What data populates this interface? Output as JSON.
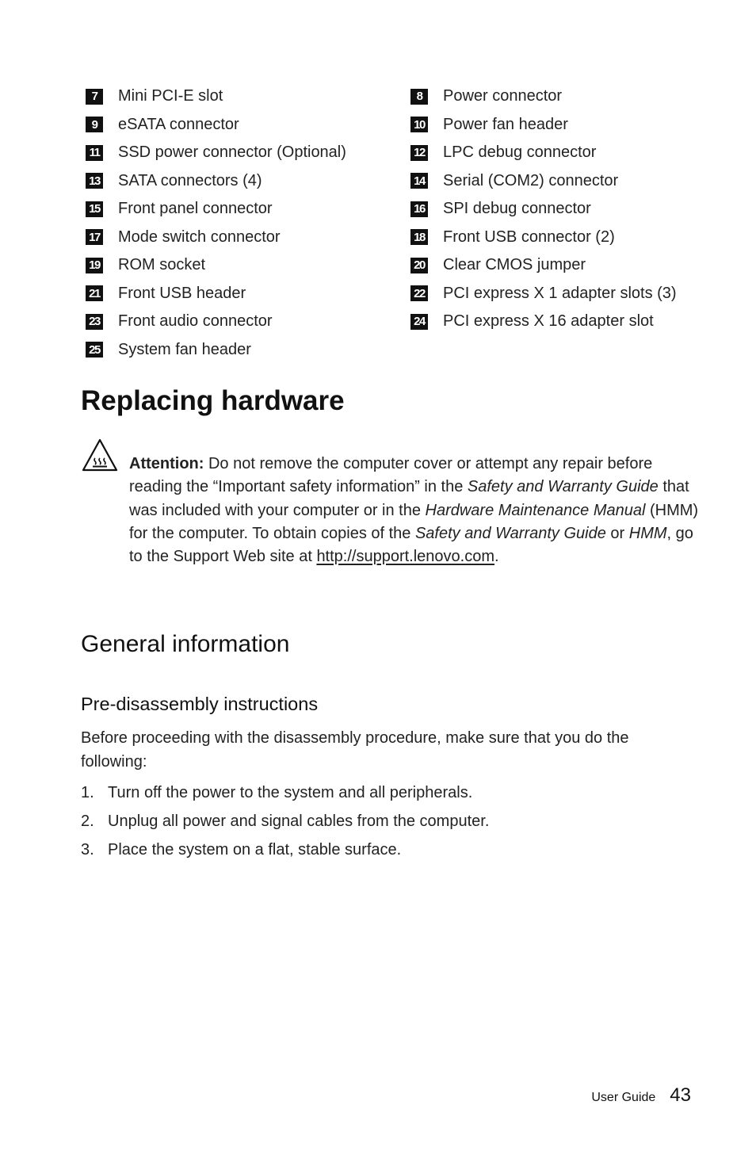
{
  "legend": {
    "left": [
      {
        "num": "7",
        "label": "Mini PCI-E slot"
      },
      {
        "num": "9",
        "label": "eSATA connector"
      },
      {
        "num": "11",
        "label": "SSD power connector (Optional)"
      },
      {
        "num": "13",
        "label": "SATA connectors (4)"
      },
      {
        "num": "15",
        "label": "Front panel connector"
      },
      {
        "num": "17",
        "label": "Mode switch connector"
      },
      {
        "num": "19",
        "label": "ROM socket"
      },
      {
        "num": "21",
        "label": "Front USB header"
      },
      {
        "num": "23",
        "label": "Front audio connector"
      },
      {
        "num": "25",
        "label": "System fan header"
      }
    ],
    "right": [
      {
        "num": "8",
        "label": "Power connector"
      },
      {
        "num": "10",
        "label": "Power fan header"
      },
      {
        "num": "12",
        "label": "LPC debug connector"
      },
      {
        "num": "14",
        "label": "Serial (COM2) connector"
      },
      {
        "num": "16",
        "label": "SPI debug connector"
      },
      {
        "num": "18",
        "label": "Front USB connector (2)"
      },
      {
        "num": "20",
        "label": "Clear CMOS jumper"
      },
      {
        "num": "22",
        "label": "PCI express X 1 adapter slots (3)"
      },
      {
        "num": "24",
        "label": "PCI express X 16 adapter slot"
      }
    ]
  },
  "section": {
    "title": "Replacing hardware",
    "attention": {
      "icon": "hot-surface-warning-icon",
      "label": "Attention:",
      "t1": " Do not remove the computer cover or attempt any repair before reading the “Important safety information” in the ",
      "i1": "Safety and Warranty Guide",
      "t2": " that was included with your computer or in the ",
      "i2": "Hardware Maintenance Manual",
      "t3": " (HMM) for the computer. To obtain copies of the ",
      "i3": "Safety and Warranty Guide",
      "t4": " or ",
      "i4": "HMM",
      "t5": ", go to the Support Web site at ",
      "link": "http://support.lenovo.com",
      "t6": "."
    }
  },
  "general": {
    "title": "General information",
    "subtitle": "Pre-disassembly instructions",
    "intro": "Before proceeding with the disassembly procedure, make sure that you do the following:",
    "steps": [
      {
        "num": "1.",
        "text": "Turn off the power to the system and all peripherals."
      },
      {
        "num": "2.",
        "text": "Unplug all power and signal cables from the computer."
      },
      {
        "num": "3.",
        "text": "Place the system on a flat, stable surface."
      }
    ]
  },
  "footer": {
    "doc_title": "User Guide",
    "page_number": "43"
  }
}
